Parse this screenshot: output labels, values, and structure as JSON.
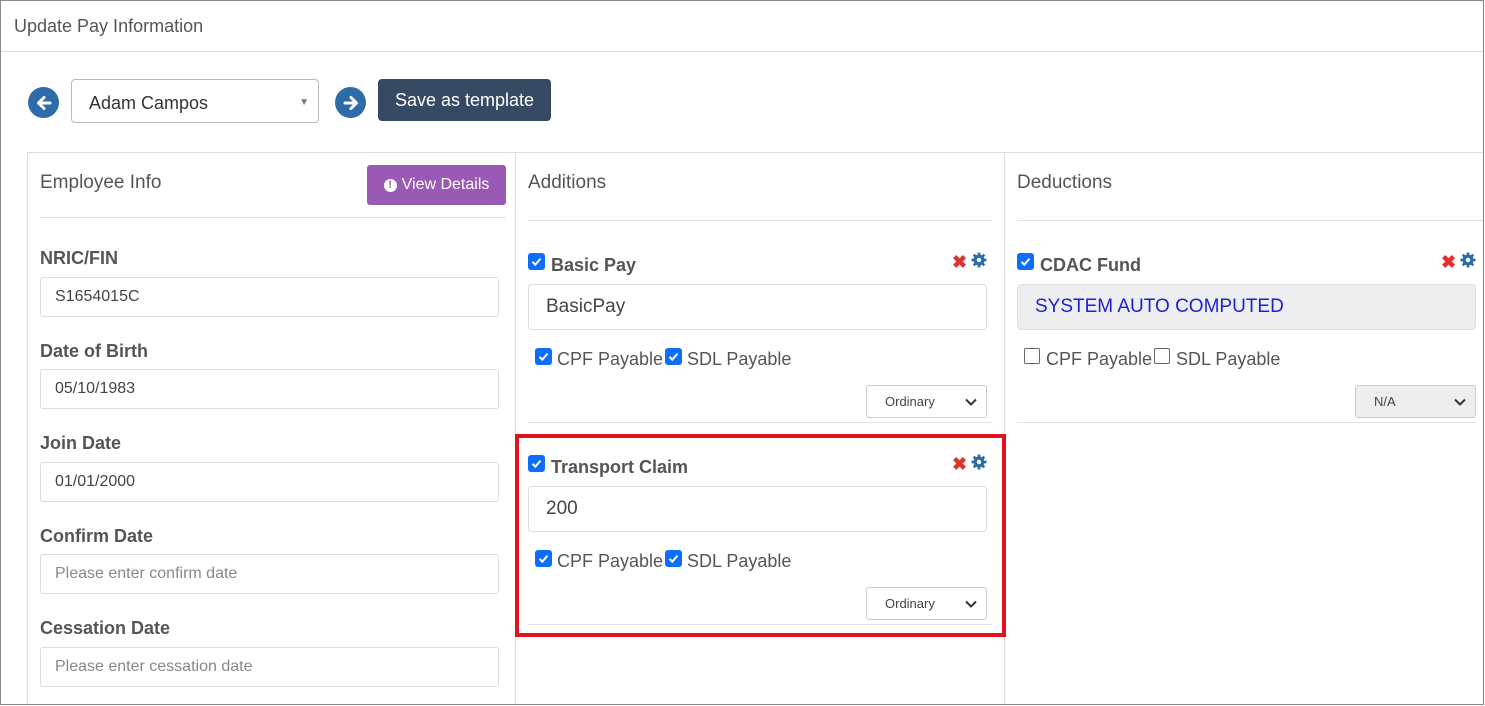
{
  "page": {
    "title": "Update Pay Information"
  },
  "toolbar": {
    "employee_selected": "Adam Campos",
    "save_template_label": "Save as template"
  },
  "employee_info": {
    "title": "Employee Info",
    "view_details_label": "View Details",
    "fields": [
      {
        "label": "NRIC/FIN",
        "value": "S1654015C",
        "placeholder": ""
      },
      {
        "label": "Date of Birth",
        "value": "05/10/1983",
        "placeholder": ""
      },
      {
        "label": "Join Date",
        "value": "01/01/2000",
        "placeholder": ""
      },
      {
        "label": "Confirm Date",
        "value": "",
        "placeholder": "Please enter confirm date"
      },
      {
        "label": "Cessation Date",
        "value": "",
        "placeholder": "Please enter cessation date"
      }
    ]
  },
  "additions": {
    "title": "Additions",
    "items": [
      {
        "name": "Basic Pay",
        "checked": true,
        "value": "BasicPay",
        "cpf_label": "CPF Payable",
        "cpf_checked": true,
        "sdl_label": "SDL Payable",
        "sdl_checked": true,
        "type": "Ordinary"
      },
      {
        "name": "Transport Claim",
        "checked": true,
        "value": "200",
        "cpf_label": "CPF Payable",
        "cpf_checked": true,
        "sdl_label": "SDL Payable",
        "sdl_checked": true,
        "type": "Ordinary"
      }
    ]
  },
  "deductions": {
    "title": "Deductions",
    "items": [
      {
        "name": "CDAC Fund",
        "checked": true,
        "value": "SYSTEM AUTO COMPUTED",
        "cpf_label": "CPF Payable",
        "cpf_checked": false,
        "sdl_label": "SDL Payable",
        "sdl_checked": false,
        "type": "N/A"
      }
    ]
  },
  "colors": {
    "accent_blue": "#2d6ca8",
    "button_dark": "#374a63",
    "button_purple": "#9b59b6",
    "highlight_red": "#e0151b",
    "checkbox_blue": "#0d6efd"
  },
  "icons": {
    "prev": "arrow-left-circle-icon",
    "next": "arrow-right-circle-icon",
    "remove": "x-icon",
    "settings": "gear-icon",
    "info": "exclamation-circle-icon"
  }
}
